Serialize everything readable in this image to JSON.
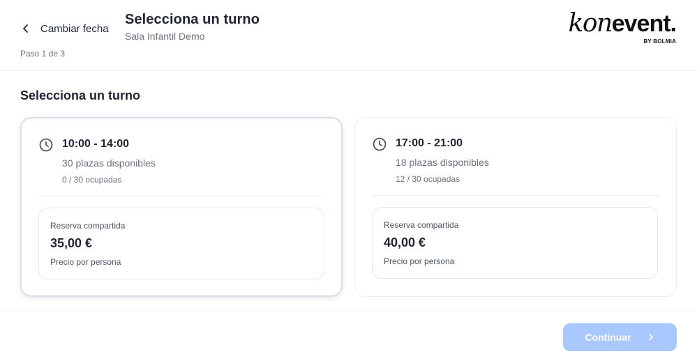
{
  "header": {
    "back_label": "Cambiar fecha",
    "title": "Selecciona un turno",
    "subtitle": "Sala Infantil Demo",
    "step": "Paso 1 de 3",
    "logo": {
      "part1": "kon",
      "part2": "event.",
      "byline": "BY BOLMIA"
    }
  },
  "section": {
    "title": "Selecciona un turno"
  },
  "shifts": [
    {
      "time": "10:00 - 14:00",
      "available": "30 plazas disponibles",
      "occupied": "0 / 30 ocupadas",
      "price_type": "Reserva compartida",
      "price": "35,00 €",
      "price_note": "Precio por persona",
      "selected": true
    },
    {
      "time": "17:00 - 21:00",
      "available": "18 plazas disponibles",
      "occupied": "12 / 30 ocupadas",
      "price_type": "Reserva compartida",
      "price": "40,00 €",
      "price_note": "Precio por persona",
      "selected": false
    }
  ],
  "footer": {
    "continue_label": "Continuar"
  },
  "colors": {
    "accent_disabled": "#a9c8ff",
    "text_primary": "#1f2433",
    "text_secondary": "#6b7280"
  },
  "icons": {
    "back": "chevron-left-icon",
    "clock": "clock-icon",
    "next": "chevron-right-icon"
  }
}
